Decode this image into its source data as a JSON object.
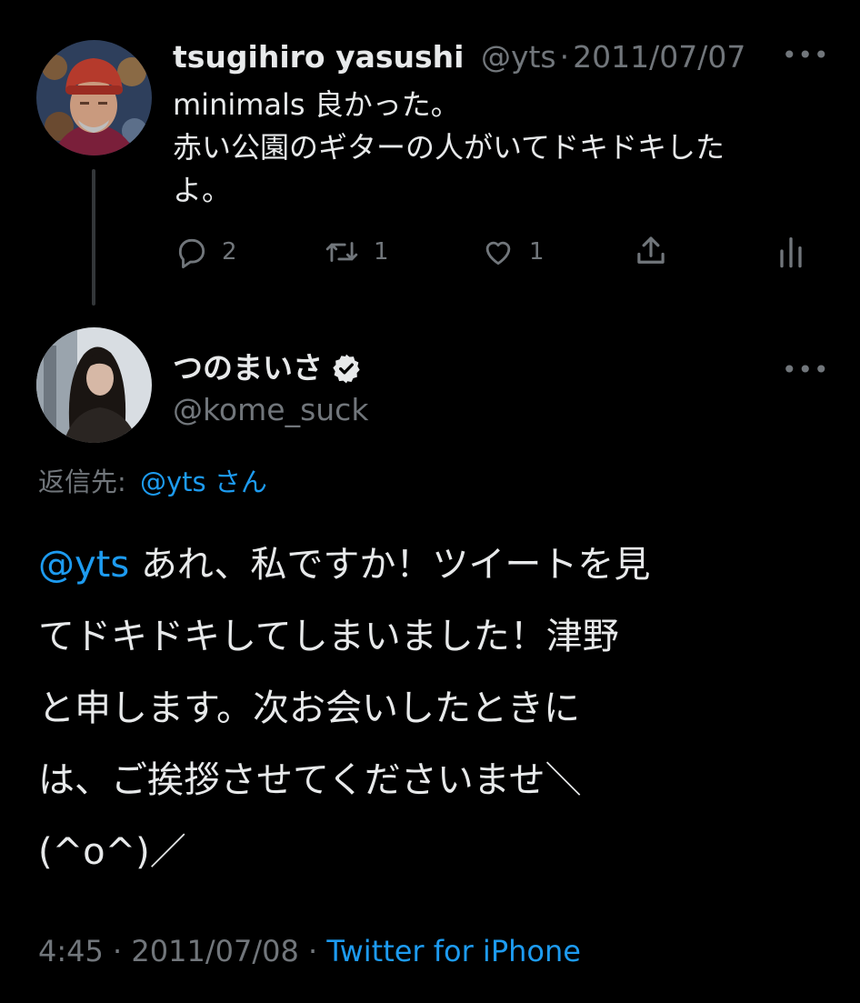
{
  "parent_tweet": {
    "author_name": "tsugihiro yasushi",
    "handle": "@yts",
    "separator": "·",
    "date": "2011/07/07",
    "text_lines": [
      "minimals 良かった。",
      "赤い公園のギターの人がいてドキドキした",
      "よ。"
    ],
    "replies": "2",
    "retweets": "1",
    "likes": "1"
  },
  "reply_tweet": {
    "author_name": "つのまいさ",
    "handle": "@kome_suck",
    "replying_label": "返信先:",
    "replying_handle": "@yts",
    "replying_suffix": "さん",
    "mention": "@yts",
    "text_first": "あれ、私ですか！ツイートを見",
    "text_lines": [
      "てドキドキしてしまいました！津野",
      "と申します。次お会いしたときに",
      "は、ご挨拶させてくださいませ＼",
      "(^o^)／"
    ],
    "time": "4:45",
    "separator1": "·",
    "date": "2011/07/08",
    "separator2": "·",
    "source": "Twitter for iPhone"
  },
  "icons": [
    "more-icon",
    "reply-icon",
    "retweet-icon",
    "like-icon",
    "share-icon",
    "analytics-icon",
    "verified-badge-icon"
  ],
  "colors": {
    "background": "#000000",
    "text": "#e7e9ea",
    "muted": "#71767b",
    "link": "#1d9bf0"
  }
}
